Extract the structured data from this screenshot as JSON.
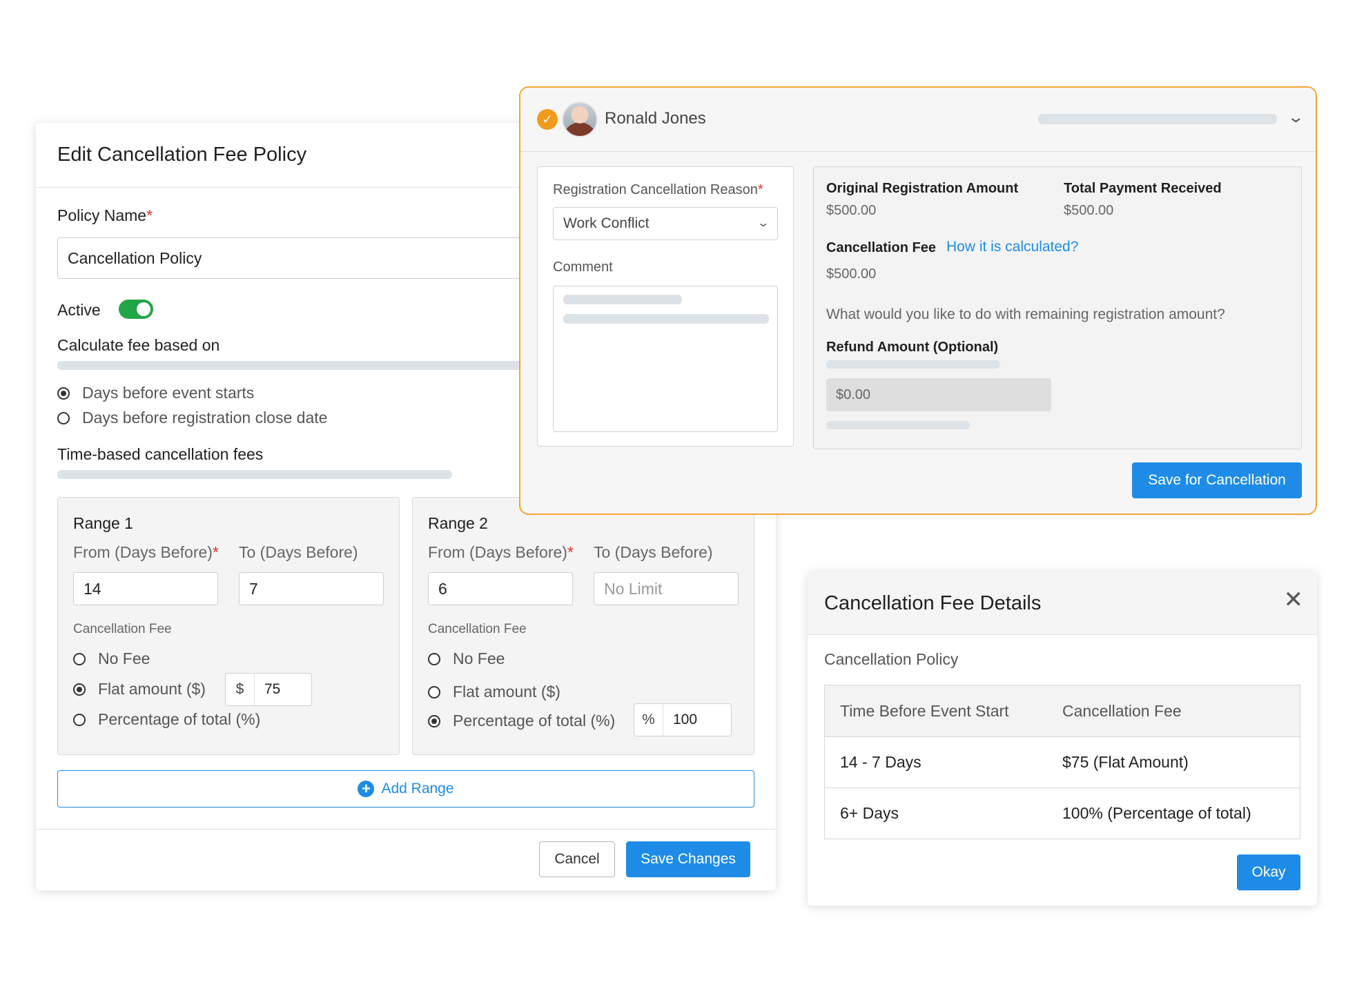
{
  "edit_policy": {
    "title": "Edit Cancellation Fee Policy",
    "policy_name_label": "Policy Name",
    "required_mark": "*",
    "policy_name_value": "Cancellation Policy",
    "active_label": "Active",
    "active_on": true,
    "calc_label": "Calculate fee based on",
    "calc_options": [
      "Days before event starts",
      "Days before registration close date"
    ],
    "calc_selected": 0,
    "time_based_label": "Time-based cancellation fees",
    "ranges": [
      {
        "title": "Range 1",
        "from_label": "From (Days Before)",
        "to_label": "To (Days Before)",
        "from_value": "14",
        "to_value": "7",
        "to_placeholder": "",
        "fee_label": "Cancellation Fee",
        "options": [
          "No Fee",
          "Flat amount ($)",
          "Percentage of total (%)"
        ],
        "selected": 1,
        "amount_unit": "$",
        "amount_value": "75"
      },
      {
        "title": "Range 2",
        "from_label": "From (Days Before)",
        "to_label": "To (Days Before)",
        "from_value": "6",
        "to_value": "",
        "to_placeholder": "No Limit",
        "fee_label": "Cancellation Fee",
        "options": [
          "No Fee",
          "Flat amount ($)",
          "Percentage of total (%)"
        ],
        "selected": 2,
        "amount_unit": "%",
        "amount_value": "100"
      }
    ],
    "add_range_label": "Add Range",
    "cancel_label": "Cancel",
    "save_label": "Save Changes"
  },
  "registration": {
    "name": "Ronald Jones",
    "reason_label": "Registration Cancellation Reason",
    "reason_value": "Work Conflict",
    "comment_label": "Comment",
    "original_amount_label": "Original Registration Amount",
    "original_amount_value": "$500.00",
    "total_payment_label": "Total Payment Received",
    "total_payment_value": "$500.00",
    "cancellation_fee_label": "Cancellation Fee",
    "how_calculated_link": "How it is calculated?",
    "cancellation_fee_value": "$500.00",
    "remaining_question": "What would you like to do with remaining registration amount?",
    "refund_label": "Refund Amount (Optional)",
    "refund_value": "$0.00",
    "save_label": "Save for Cancellation"
  },
  "fee_details": {
    "title": "Cancellation Fee Details",
    "subtitle": "Cancellation Policy",
    "columns": [
      "Time Before Event Start",
      "Cancellation Fee"
    ],
    "rows": [
      [
        "14 - 7 Days",
        "$75 (Flat Amount)"
      ],
      [
        "6+ Days",
        "100% (Percentage of total)"
      ]
    ],
    "okay_label": "Okay"
  },
  "colors": {
    "accent": "#1e8ce6",
    "toggle_on": "#22a547",
    "highlight_border": "#f4a332",
    "required": "#e0302a"
  }
}
